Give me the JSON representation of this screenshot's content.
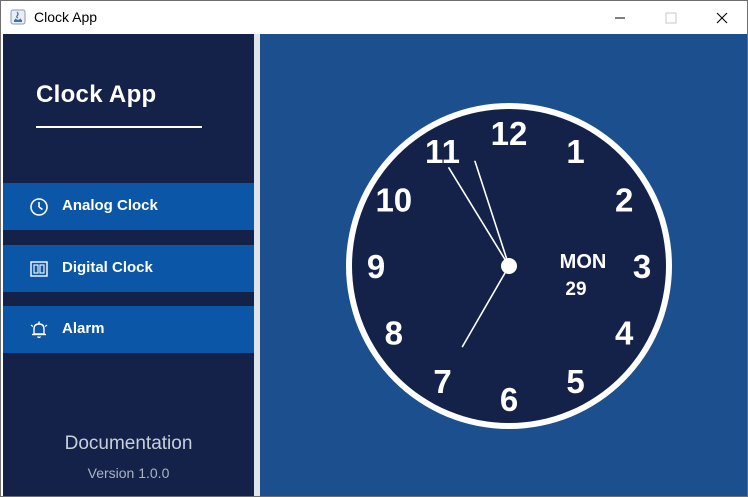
{
  "window": {
    "title": "Clock App",
    "controls": {
      "minimize": "minimize",
      "maximize": "maximize",
      "close": "close"
    }
  },
  "sidebar": {
    "brand": "Clock App",
    "items": [
      {
        "label": "Analog Clock",
        "icon": "clock-icon"
      },
      {
        "label": "Digital Clock",
        "icon": "digital-clock-icon"
      },
      {
        "label": "Alarm",
        "icon": "alarm-bell-icon"
      }
    ],
    "documentation": "Documentation",
    "version": "Version 1.0.0"
  },
  "clock": {
    "numerals": [
      "12",
      "1",
      "2",
      "3",
      "4",
      "5",
      "6",
      "7",
      "8",
      "9",
      "10",
      "11"
    ],
    "day": "MON",
    "date": "29",
    "time": {
      "hour": 10,
      "minute": 57,
      "second": 35
    }
  },
  "colors": {
    "sidebar": "#14224a",
    "nav_active": "#0b56a6",
    "main": "#1b4f8e",
    "clock_face": "#14224a",
    "clock_border": "#ffffff"
  }
}
